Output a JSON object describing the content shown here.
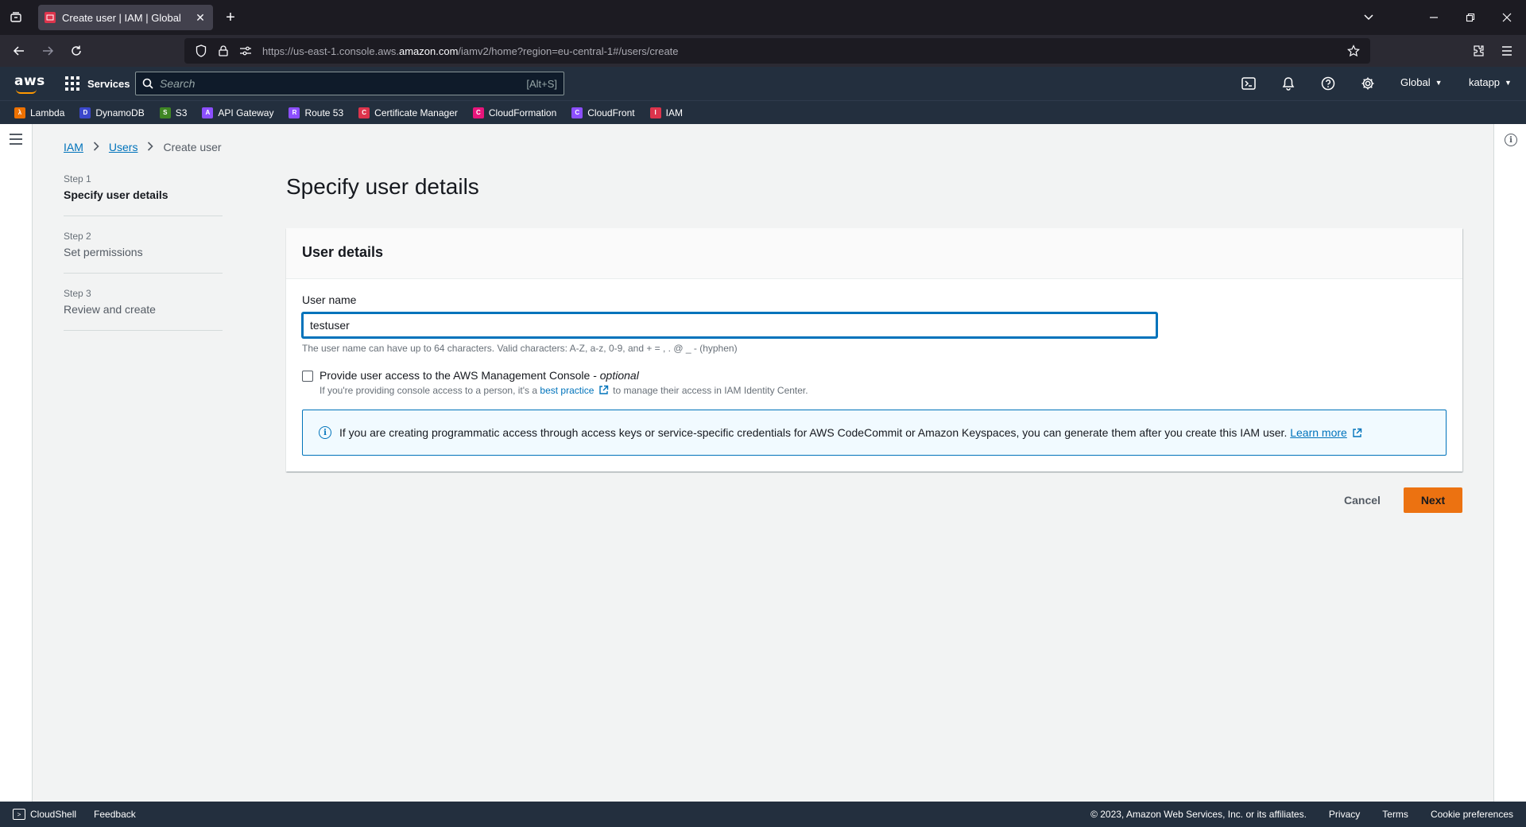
{
  "browser": {
    "tab_title": "Create user | IAM | Global",
    "url_prefix": "https://us-east-1.console.aws.",
    "url_domain": "amazon.com",
    "url_suffix": "/iamv2/home?region=eu-central-1#/users/create"
  },
  "aws_header": {
    "logo": "aws",
    "services_label": "Services",
    "search_placeholder": "Search",
    "search_shortcut": "[Alt+S]",
    "region_label": "Global",
    "account_label": "katapp"
  },
  "favorites": [
    {
      "label": "Lambda",
      "color": "#ed7100"
    },
    {
      "label": "DynamoDB",
      "color": "#3b48cc"
    },
    {
      "label": "S3",
      "color": "#3f8624"
    },
    {
      "label": "API Gateway",
      "color": "#8c4fff"
    },
    {
      "label": "Route 53",
      "color": "#8c4fff"
    },
    {
      "label": "Certificate Manager",
      "color": "#dd344c"
    },
    {
      "label": "CloudFormation",
      "color": "#e7157b"
    },
    {
      "label": "CloudFront",
      "color": "#8c4fff"
    },
    {
      "label": "IAM",
      "color": "#dd344c"
    }
  ],
  "breadcrumb": {
    "iam": "IAM",
    "users": "Users",
    "current": "Create user"
  },
  "steps": [
    {
      "num": "Step 1",
      "label": "Specify user details",
      "active": true
    },
    {
      "num": "Step 2",
      "label": "Set permissions",
      "active": false
    },
    {
      "num": "Step 3",
      "label": "Review and create",
      "active": false
    }
  ],
  "page_title": "Specify user details",
  "panel": {
    "title": "User details",
    "username_label": "User name",
    "username_value": "testuser",
    "username_hint": "The user name can have up to 64 characters. Valid characters: A-Z, a-z, 0-9, and + = , . @ _ - (hyphen)",
    "console_access_label": "Provide user access to the AWS Management Console - ",
    "console_access_optional": "optional",
    "console_access_checked": false,
    "console_desc_pre": "If you're providing console access to a person, it's a ",
    "console_desc_link": "best practice",
    "console_desc_post": " to manage their access in IAM Identity Center.",
    "alert_text": "If you are creating programmatic access through access keys or service-specific credentials for AWS CodeCommit or Amazon Keyspaces, you can generate them after you create this IAM user. ",
    "alert_link": "Learn more"
  },
  "actions": {
    "cancel": "Cancel",
    "next": "Next"
  },
  "footer": {
    "cloudshell": "CloudShell",
    "feedback": "Feedback",
    "copyright": "© 2023, Amazon Web Services, Inc. or its affiliates.",
    "privacy": "Privacy",
    "terms": "Terms",
    "cookies": "Cookie preferences"
  },
  "colors": {
    "aws_navy": "#232f3e",
    "link_blue": "#0073bb",
    "primary_orange": "#ec7211"
  }
}
